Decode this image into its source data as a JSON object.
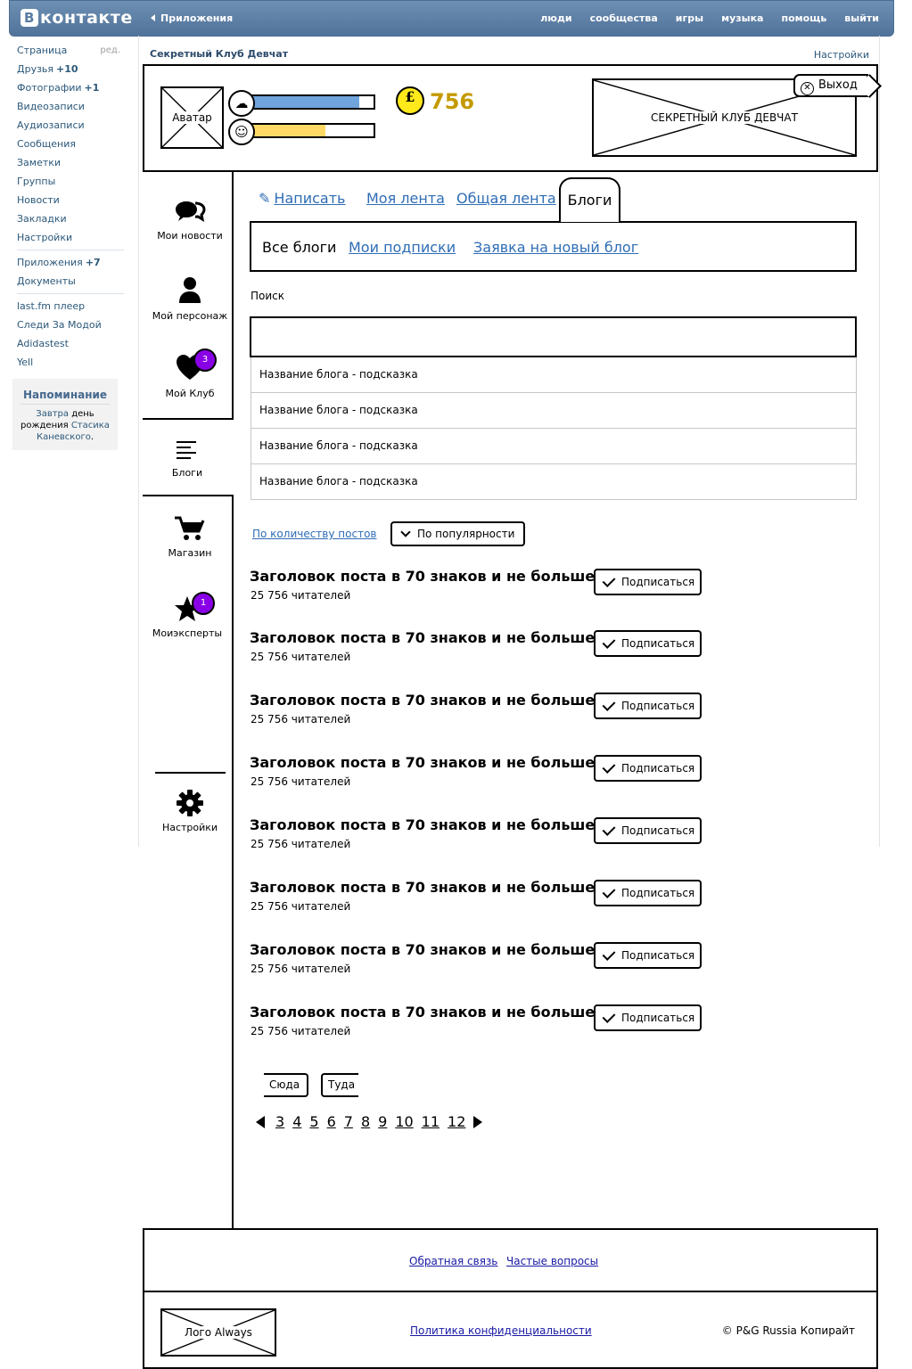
{
  "vk": {
    "logo_letter": "В",
    "logo": "контакте",
    "apps_link": "Приложения",
    "topnav": [
      "люди",
      "сообщества",
      "игры",
      "музыка",
      "помощь",
      "выйти"
    ],
    "menu": [
      {
        "label": "Страница",
        "extra": "",
        "edit": "ред."
      },
      {
        "label": "Друзья",
        "extra": "+10"
      },
      {
        "label": "Фотографии",
        "extra": "+1"
      },
      {
        "label": "Видеозаписи",
        "extra": ""
      },
      {
        "label": "Аудиозаписи",
        "extra": ""
      },
      {
        "label": "Сообщения",
        "extra": ""
      },
      {
        "label": "Заметки",
        "extra": ""
      },
      {
        "label": "Группы",
        "extra": ""
      },
      {
        "label": "Новости",
        "extra": ""
      },
      {
        "label": "Закладки",
        "extra": ""
      },
      {
        "label": "Настройки",
        "extra": ""
      },
      {
        "label": "Приложения",
        "extra": "+7"
      },
      {
        "label": "Документы",
        "extra": ""
      },
      {
        "label": "last.fm плеер",
        "extra": ""
      },
      {
        "label": "Следи За Модой",
        "extra": ""
      },
      {
        "label": "Adidastest",
        "extra": ""
      },
      {
        "label": "Yell",
        "extra": ""
      }
    ],
    "reminder": {
      "title": "Напоминание",
      "w1": "Завтра",
      "w2": " день рождения ",
      "w3": "Стасика Каневского",
      "w4": "."
    }
  },
  "club": {
    "title": "Секретный Клуб Девчат",
    "settings": "Настройки",
    "avatar": "Аватар",
    "bar1_fill": 0.89,
    "bar2_fill": 0.63,
    "bar1_color": "#6fa4dc",
    "bar2_color": "#ffd966",
    "coin_symbol": "£",
    "coins": "756",
    "banner": "СЕКРЕТНЫЙ КЛУБ ДЕВЧАТ",
    "exit": "Выход"
  },
  "sidenav": {
    "news": "Мои новости",
    "character": "Мой персонаж",
    "club": "Мой Клуб",
    "club_badge": "3",
    "blogs": "Блоги",
    "shop": "Магазин",
    "experts": "Моиэксперты",
    "experts_badge": "1",
    "settings": "Настройки"
  },
  "tabs": {
    "write": "Написать",
    "my_feed": "Моя лента",
    "common_feed": "Общая лента",
    "blogs": "Блоги"
  },
  "subtabs": {
    "all": "Все блоги",
    "subs": "Мои подписки",
    "request": "Заявка на новый блог"
  },
  "search": {
    "label": "Поиск",
    "suggestions": [
      "Название блога - подсказка",
      "Название блога - подсказка",
      "Название блога - подсказка",
      "Название блога - подсказка"
    ]
  },
  "sort": {
    "by_posts": "По количеству постов",
    "by_popularity": "По популярности"
  },
  "posts": [
    {
      "title": "Заголовок поста в 70 знаков и не больше",
      "readers": "25 756 читателей",
      "button": "Подписаться"
    },
    {
      "title": "Заголовок поста в 70 знаков и не больше",
      "readers": "25 756 читателей",
      "button": "Подписаться"
    },
    {
      "title": "Заголовок поста в 70 знаков и не больше",
      "readers": "25 756 читателей",
      "button": "Подписаться"
    },
    {
      "title": "Заголовок поста в 70 знаков и не больше",
      "readers": "25 756 читателей",
      "button": "Подписаться"
    },
    {
      "title": "Заголовок поста в 70 знаков и не больше",
      "readers": "25 756 читателей",
      "button": "Подписаться"
    },
    {
      "title": "Заголовок поста в 70 знаков и не больше",
      "readers": "25 756 читателей",
      "button": "Подписаться"
    },
    {
      "title": "Заголовок поста в 70 знаков и не больше",
      "readers": "25 756 читателей",
      "button": "Подписаться"
    },
    {
      "title": "Заголовок поста в 70 знаков и не больше",
      "readers": "25 756 читателей",
      "button": "Подписаться"
    }
  ],
  "pagination": {
    "prev": "Сюда",
    "next": "Туда",
    "pages": [
      "3",
      "4",
      "5",
      "6",
      "7",
      "8",
      "9",
      "10",
      "11",
      "12"
    ]
  },
  "footer": {
    "feedback": "Обратная связь",
    "faq": "Частые вопросы",
    "logo": "Лого Always",
    "privacy": "Политика конфиденциальности",
    "copyright": "© P&G Russia Копирайт"
  }
}
